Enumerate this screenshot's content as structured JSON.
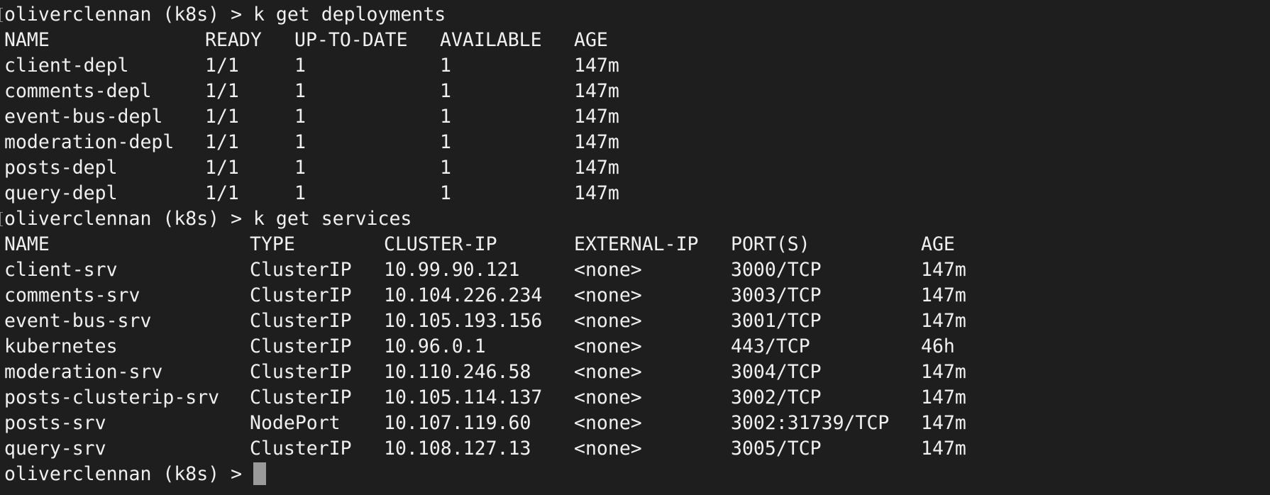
{
  "theme": {
    "background": "#1e1e1e",
    "foreground": "#f0f0f0",
    "cursor": "#9a9a9a"
  },
  "session": {
    "prompt": "oliverclennan (k8s) > "
  },
  "deployments": {
    "command": "k get deployments",
    "headers": [
      "NAME",
      "READY",
      "UP-TO-DATE",
      "AVAILABLE",
      "AGE"
    ],
    "rows": [
      [
        "client-depl",
        "1/1",
        "1",
        "1",
        "147m"
      ],
      [
        "comments-depl",
        "1/1",
        "1",
        "1",
        "147m"
      ],
      [
        "event-bus-depl",
        "1/1",
        "1",
        "1",
        "147m"
      ],
      [
        "moderation-depl",
        "1/1",
        "1",
        "1",
        "147m"
      ],
      [
        "posts-depl",
        "1/1",
        "1",
        "1",
        "147m"
      ],
      [
        "query-depl",
        "1/1",
        "1",
        "1",
        "147m"
      ]
    ]
  },
  "services": {
    "command": "k get services",
    "headers": [
      "NAME",
      "TYPE",
      "CLUSTER-IP",
      "EXTERNAL-IP",
      "PORT(S)",
      "AGE"
    ],
    "rows": [
      [
        "client-srv",
        "ClusterIP",
        "10.99.90.121",
        "<none>",
        "3000/TCP",
        "147m"
      ],
      [
        "comments-srv",
        "ClusterIP",
        "10.104.226.234",
        "<none>",
        "3003/TCP",
        "147m"
      ],
      [
        "event-bus-srv",
        "ClusterIP",
        "10.105.193.156",
        "<none>",
        "3001/TCP",
        "147m"
      ],
      [
        "kubernetes",
        "ClusterIP",
        "10.96.0.1",
        "<none>",
        "443/TCP",
        "46h"
      ],
      [
        "moderation-srv",
        "ClusterIP",
        "10.110.246.58",
        "<none>",
        "3004/TCP",
        "147m"
      ],
      [
        "posts-clusterip-srv",
        "ClusterIP",
        "10.105.114.137",
        "<none>",
        "3002/TCP",
        "147m"
      ],
      [
        "posts-srv",
        "NodePort",
        "10.107.119.60",
        "<none>",
        "3002:31739/TCP",
        "147m"
      ],
      [
        "query-srv",
        "ClusterIP",
        "10.108.127.13",
        "<none>",
        "3005/TCP",
        "147m"
      ]
    ]
  },
  "final_prompt": {
    "prompt": "oliverclennan (k8s) > ",
    "input": ""
  }
}
